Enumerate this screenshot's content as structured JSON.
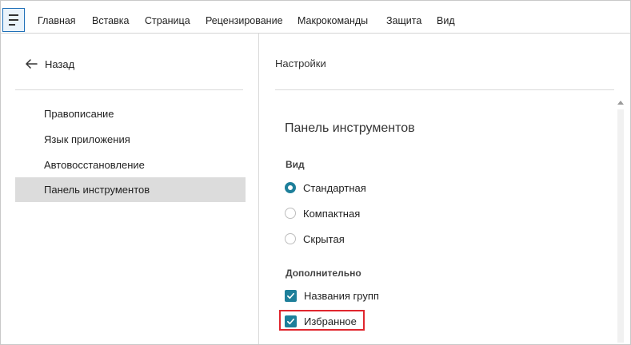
{
  "menu": {
    "items": [
      "Главная",
      "Вставка",
      "Страница",
      "Рецензирование",
      "Макрокоманды",
      "Защита",
      "Вид"
    ]
  },
  "sidebar": {
    "back_label": "Назад",
    "items": [
      {
        "label": "Правописание"
      },
      {
        "label": "Язык приложения"
      },
      {
        "label": "Автовосстановление"
      },
      {
        "label": "Панель инструментов"
      }
    ]
  },
  "main": {
    "header": "Настройки",
    "section_title": "Панель инструментов",
    "view_group": {
      "title": "Вид",
      "options": [
        {
          "label": "Стандартная",
          "checked": true
        },
        {
          "label": "Компактная",
          "checked": false
        },
        {
          "label": "Скрытая",
          "checked": false
        }
      ]
    },
    "extra_group": {
      "title": "Дополнительно",
      "options": [
        {
          "label": "Названия групп",
          "checked": true
        },
        {
          "label": "Избранное",
          "checked": true
        }
      ]
    }
  },
  "colors": {
    "accent": "#1e7f9a",
    "active_item_bg": "#dcdcdc",
    "highlight": "#e0262e"
  },
  "icons": {
    "menu": "hamburger-icon",
    "back": "arrow-left-icon",
    "check": "checkmark-icon"
  }
}
